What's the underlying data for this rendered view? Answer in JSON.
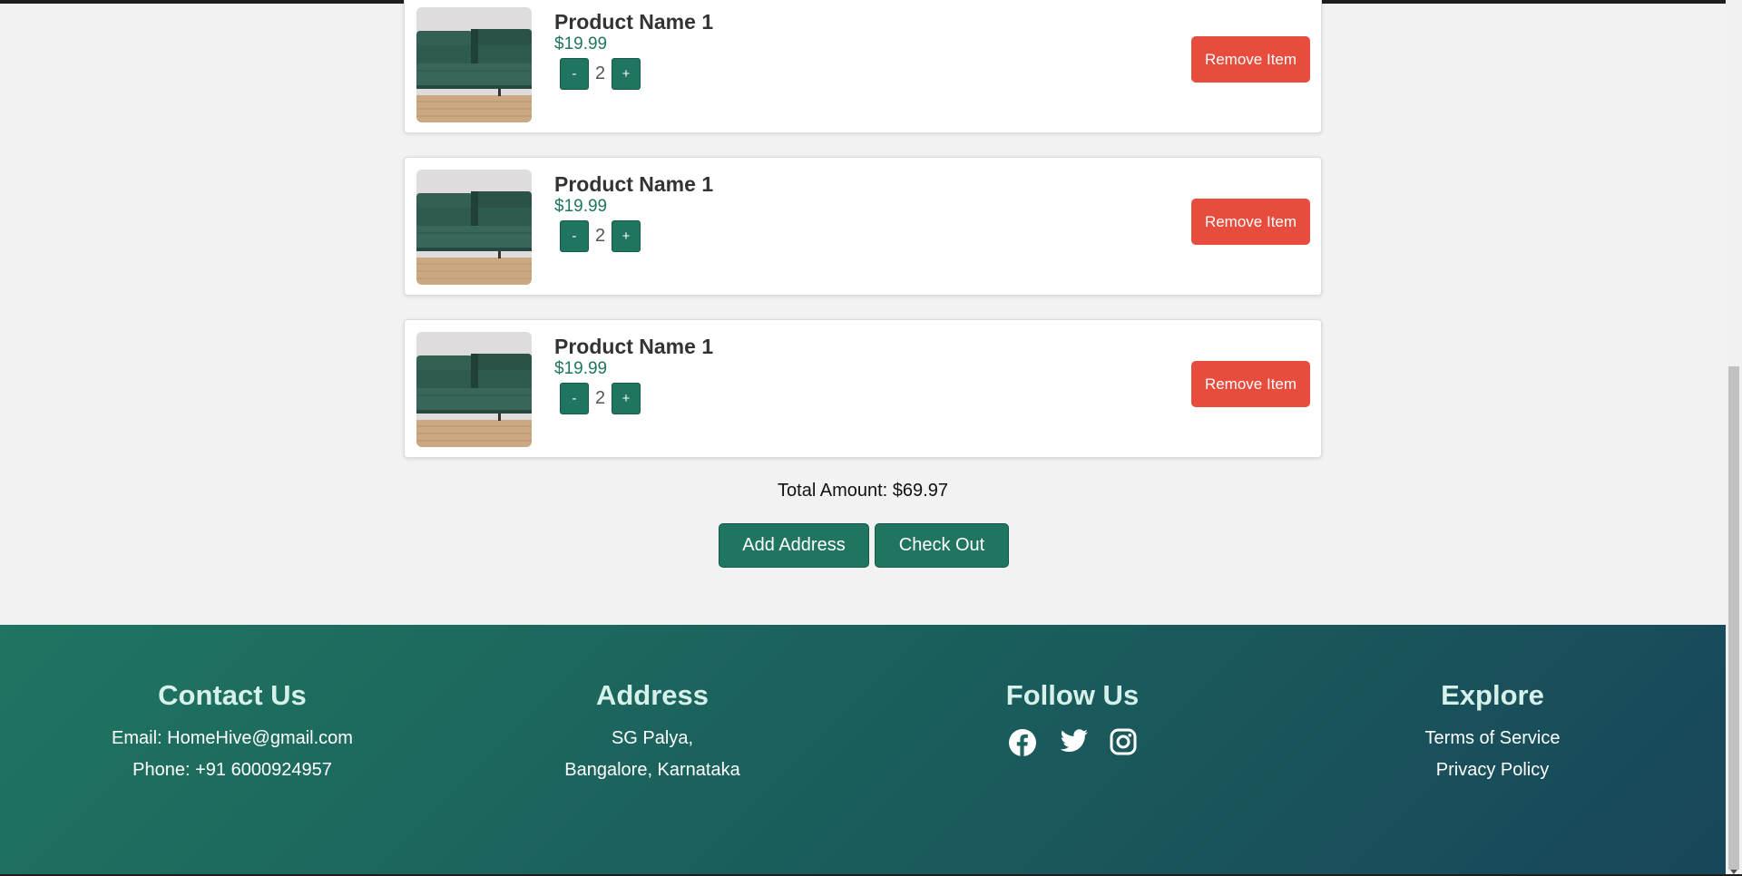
{
  "cart": {
    "items": [
      {
        "name": "Product Name 1",
        "price": "$19.99",
        "quantity": "2",
        "decrement_label": "-",
        "increment_label": "+",
        "remove_label": "Remove Item"
      },
      {
        "name": "Product Name 1",
        "price": "$19.99",
        "quantity": "2",
        "decrement_label": "-",
        "increment_label": "+",
        "remove_label": "Remove Item"
      },
      {
        "name": "Product Name 1",
        "price": "$19.99",
        "quantity": "2",
        "decrement_label": "-",
        "increment_label": "+",
        "remove_label": "Remove Item"
      }
    ],
    "total_label": "Total Amount: $69.97",
    "add_address_label": "Add Address",
    "checkout_label": "Check Out"
  },
  "footer": {
    "contact": {
      "heading": "Contact Us",
      "email": "Email: HomeHive@gmail.com",
      "phone": "Phone: +91 6000924957"
    },
    "address": {
      "heading": "Address",
      "line1": "SG Palya,",
      "line2": "Bangalore, Karnataka"
    },
    "follow": {
      "heading": "Follow Us",
      "icons": [
        "facebook-icon",
        "twitter-icon",
        "instagram-icon"
      ]
    },
    "explore": {
      "heading": "Explore",
      "links": [
        "Terms of Service",
        "Privacy Policy"
      ]
    }
  },
  "colors": {
    "primary": "#1f7560",
    "danger": "#e74c3c",
    "background": "#f2f2f2"
  }
}
